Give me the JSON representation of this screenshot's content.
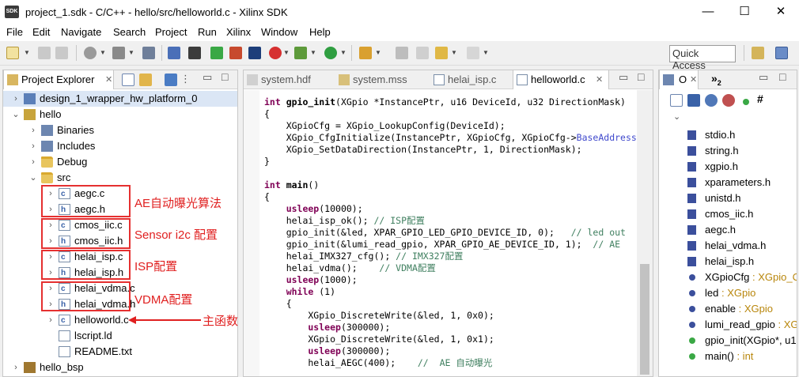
{
  "window": {
    "title": "project_1.sdk - C/C++ - hello/src/helloworld.c - Xilinx SDK",
    "logo_text": "SDK",
    "minimize": "—",
    "maximize": "☐",
    "close": "✕"
  },
  "menu": [
    "File",
    "Edit",
    "Navigate",
    "Search",
    "Project",
    "Run",
    "Xilinx",
    "Window",
    "Help"
  ],
  "toolbar": {
    "quick_access": "Quick Access"
  },
  "project_explorer": {
    "title": "Project Explorer",
    "items": [
      {
        "label": "design_1_wrapper_hw_platform_0",
        "depth": 0,
        "twisty": "›",
        "kind": "hw"
      },
      {
        "label": "hello",
        "depth": 0,
        "twisty": "⌄",
        "kind": "project"
      },
      {
        "label": "Binaries",
        "depth": 1,
        "twisty": "›",
        "kind": "bin"
      },
      {
        "label": "Includes",
        "depth": 1,
        "twisty": "›",
        "kind": "inc"
      },
      {
        "label": "Debug",
        "depth": 1,
        "twisty": "›",
        "kind": "folder"
      },
      {
        "label": "src",
        "depth": 1,
        "twisty": "⌄",
        "kind": "folder"
      },
      {
        "label": "aegc.c",
        "depth": 2,
        "twisty": "›",
        "kind": "c"
      },
      {
        "label": "aegc.h",
        "depth": 2,
        "twisty": "›",
        "kind": "h"
      },
      {
        "label": "cmos_iic.c",
        "depth": 2,
        "twisty": "›",
        "kind": "c"
      },
      {
        "label": "cmos_iic.h",
        "depth": 2,
        "twisty": "›",
        "kind": "h"
      },
      {
        "label": "helai_isp.c",
        "depth": 2,
        "twisty": "›",
        "kind": "c"
      },
      {
        "label": "helai_isp.h",
        "depth": 2,
        "twisty": "›",
        "kind": "h"
      },
      {
        "label": "helai_vdma.c",
        "depth": 2,
        "twisty": "›",
        "kind": "c"
      },
      {
        "label": "helai_vdma.h",
        "depth": 2,
        "twisty": "›",
        "kind": "h"
      },
      {
        "label": "helloworld.c",
        "depth": 2,
        "twisty": "›",
        "kind": "c"
      },
      {
        "label": "lscript.ld",
        "depth": 2,
        "twisty": "",
        "kind": "ld"
      },
      {
        "label": "README.txt",
        "depth": 2,
        "twisty": "",
        "kind": "txt"
      },
      {
        "label": "hello_bsp",
        "depth": 0,
        "twisty": "›",
        "kind": "bsp"
      }
    ]
  },
  "annotations": {
    "aegc": "AE自动曝光算法",
    "cmos": "Sensor i2c 配置",
    "isp": "ISP配置",
    "vdma": "VDMA配置",
    "main": "主函数"
  },
  "editor": {
    "tabs": [
      "system.hdf",
      "system.mss",
      "helai_isp.c",
      "helloworld.c"
    ],
    "active_tab": "helloworld.c",
    "lines": [
      [
        "int ",
        "gpio_init",
        "(XGpio *InstancePtr, u16 DeviceId, u32 DirectionMask)"
      ],
      [
        "{"
      ],
      [
        "    XGpioCfg = XGpio_LookupConfig(DeviceId);"
      ],
      [
        "    XGpio_CfgInitialize(InstancePtr, XGpioCfg, XGpioCfg->",
        "BaseAddress"
      ],
      [
        "    XGpio_SetDataDirection(InstancePtr, 1, DirectionMask);"
      ],
      [
        "}"
      ],
      [
        ""
      ],
      [
        "int ",
        "main",
        "()"
      ],
      [
        "{"
      ],
      [
        "    usleep",
        "(10000);"
      ],
      [
        "    helai_isp_ok(); ",
        "// ISP配置"
      ],
      [
        "    gpio_init(&led, XPAR_GPIO_LED_GPIO_DEVICE_ID, 0);   ",
        "// led out"
      ],
      [
        "    gpio_init(&lumi_read_gpio, XPAR_GPIO_AE_DEVICE_ID, 1);  ",
        "// AE"
      ],
      [
        "    helai_IMX327_cfg(); ",
        "// IMX327配置"
      ],
      [
        "    helai_vdma();    ",
        "// VDMA配置"
      ],
      [
        "    usleep",
        "(1000);"
      ],
      [
        "    while ",
        "(1)"
      ],
      [
        "    {"
      ],
      [
        "        XGpio_DiscreteWrite(&led, 1, 0x0);"
      ],
      [
        "        usleep",
        "(300000);"
      ],
      [
        "        XGpio_DiscreteWrite(&led, 1, 0x1);"
      ],
      [
        "        usleep",
        "(300000);"
      ],
      [
        "        helai_AEGC(400);    ",
        "//  AE 自动曝光"
      ]
    ]
  },
  "outline": {
    "tab_label": "O",
    "tab2_label": "»",
    "tab2_count": "2",
    "items": [
      {
        "label": "stdio.h",
        "type": "",
        "kind": "include"
      },
      {
        "label": "string.h",
        "type": "",
        "kind": "include"
      },
      {
        "label": "xgpio.h",
        "type": "",
        "kind": "include"
      },
      {
        "label": "xparameters.h",
        "type": "",
        "kind": "include"
      },
      {
        "label": "unistd.h",
        "type": "",
        "kind": "include"
      },
      {
        "label": "cmos_iic.h",
        "type": "",
        "kind": "include"
      },
      {
        "label": "aegc.h",
        "type": "",
        "kind": "include"
      },
      {
        "label": "helai_vdma.h",
        "type": "",
        "kind": "include"
      },
      {
        "label": "helai_isp.h",
        "type": "",
        "kind": "include"
      },
      {
        "label": "XGpioCfg",
        "type": " : XGpio_C",
        "kind": "var"
      },
      {
        "label": "led",
        "type": " : XGpio",
        "kind": "var"
      },
      {
        "label": "enable",
        "type": " : XGpio",
        "kind": "var"
      },
      {
        "label": "lumi_read_gpio",
        "type": " : XG",
        "kind": "var"
      },
      {
        "label": "gpio_init(XGpio*, u1",
        "type": "",
        "kind": "func"
      },
      {
        "label": "main()",
        "type": " : int",
        "kind": "func"
      }
    ]
  }
}
